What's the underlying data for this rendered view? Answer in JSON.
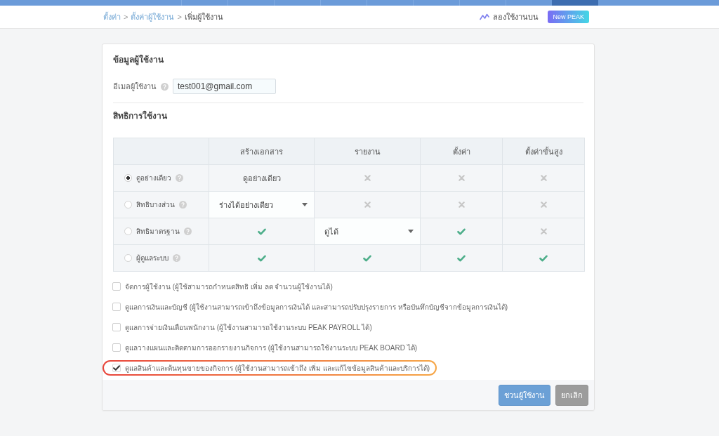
{
  "top_nav": {
    "tabs": [
      {
        "selected": false
      },
      {
        "selected": false
      },
      {
        "selected": false
      },
      {
        "selected": false
      },
      {
        "selected": false
      },
      {
        "selected": false
      },
      {
        "selected": false
      },
      {
        "selected": false
      },
      {
        "selected": true
      }
    ]
  },
  "breadcrumb": [
    {
      "kind": "link",
      "label": "ตั้งค่า"
    },
    {
      "kind": "separator",
      "label": ">"
    },
    {
      "kind": "link",
      "label": "ตั้งค่าผู้ใช้งาน"
    },
    {
      "kind": "separator",
      "label": ">"
    },
    {
      "kind": "current",
      "label": "เพิ่มผู้ใช้งาน"
    }
  ],
  "trial": {
    "label": "ลองใช้งานบน",
    "badge": "New PEAK"
  },
  "user_info": {
    "title": "ข้อมูลผู้ใช้งาน",
    "email": {
      "label": "อีเมลผู้ใช้งาน",
      "value": "test001@gmail.com"
    }
  },
  "permissions": {
    "title": "สิทธิการใช้งาน",
    "columns": [
      "สร้างเอกสาร",
      "รายงาน",
      "ตั้งค่า",
      "ตั้งค่าขั้นสูง"
    ],
    "rows": [
      {
        "label": "ดูอย่างเดียว",
        "selected": true,
        "cells": [
          {
            "kind": "text",
            "value": "ดูอย่างเดียว"
          },
          {
            "kind": "cross"
          },
          {
            "kind": "cross"
          },
          {
            "kind": "cross"
          }
        ]
      },
      {
        "label": "สิทธิบางส่วน",
        "selected": false,
        "cells": [
          {
            "kind": "select",
            "value": "ร่างได้อย่างเดียว"
          },
          {
            "kind": "cross"
          },
          {
            "kind": "cross"
          },
          {
            "kind": "cross"
          }
        ]
      },
      {
        "label": "สิทธิมาตรฐาน",
        "selected": false,
        "cells": [
          {
            "kind": "check"
          },
          {
            "kind": "select",
            "value": "ดูได้"
          },
          {
            "kind": "check"
          },
          {
            "kind": "cross"
          }
        ]
      },
      {
        "label": "ผู้ดูแลระบบ",
        "selected": false,
        "cells": [
          {
            "kind": "check"
          },
          {
            "kind": "check"
          },
          {
            "kind": "check"
          },
          {
            "kind": "check"
          }
        ]
      }
    ]
  },
  "options": [
    {
      "label": "จัดการผู้ใช้งาน (ผู้ใช้สามารถกำหนดสิทธิ เพิ่ม ลด จำนวนผู้ใช้งานได้)",
      "checked": false,
      "highlighted": false
    },
    {
      "label": "ดูแลการเงินและบัญชี (ผู้ใช้งานสามารถเข้าถึงข้อมูลการเงินได้ และสามารถปรับปรุงรายการ หรือบันทึกบัญชีจากข้อมูลการเงินได้)",
      "checked": false,
      "highlighted": false
    },
    {
      "label": "ดูแลการจ่ายเงินเดือนพนักงาน (ผู้ใช้งานสามารถใช้งานระบบ PEAK PAYROLL ได้)",
      "checked": false,
      "highlighted": false
    },
    {
      "label": "ดูแลวางแผนและติดตามการออกรายงานกิจการ (ผู้ใช้งานสามารถใช้งานระบบ PEAK BOARD ได้)",
      "checked": false,
      "highlighted": false
    },
    {
      "label": "ดูแลสินค้าและต้นทุนขายของกิจการ (ผู้ใช้งานสามารถเข้าถึง เพิ่ม และแก้ไขข้อมูลสินค้าและบริการได้)",
      "checked": true,
      "highlighted": true
    }
  ],
  "buttons": [
    {
      "kind": "primary",
      "label": "ชวนผู้ใช้งาน"
    },
    {
      "kind": "secondary",
      "label": "ยกเลิก"
    }
  ]
}
